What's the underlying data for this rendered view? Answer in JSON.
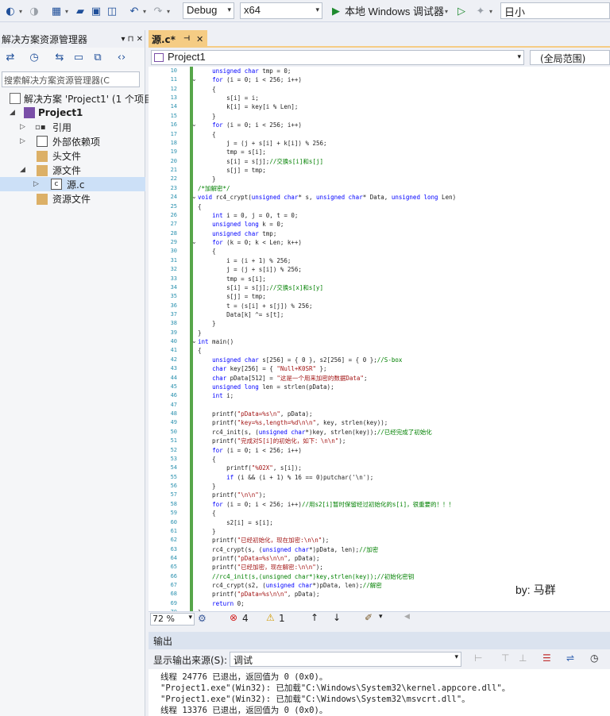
{
  "toolbar": {
    "config": "Debug",
    "platform": "x64",
    "run_label": "本地 Windows 调试器",
    "search": "日小"
  },
  "solution_explorer": {
    "title": "解决方案资源管理器",
    "pin": "▾ ⊓ ✕",
    "search_placeholder": "搜索解决方案资源管理器(C",
    "items": [
      {
        "label": "解决方案 'Project1' (1 个项目"
      },
      {
        "label": "Project1"
      },
      {
        "label": "引用"
      },
      {
        "label": "外部依赖项"
      },
      {
        "label": "头文件"
      },
      {
        "label": "源文件"
      },
      {
        "label": "源.c"
      },
      {
        "label": "资源文件"
      }
    ]
  },
  "editor": {
    "tab": "源.c*",
    "nav_project": "Project1",
    "nav_scope": "(全局范围)",
    "zoom": "72 %",
    "errors": "4",
    "warnings": "1",
    "byline": "by:  马群",
    "lines": [
      {
        "n": "10",
        "t": "    unsigned char tmp = 0;"
      },
      {
        "n": "11",
        "t": "    for (i = 0; i < 256; i++)"
      },
      {
        "n": "12",
        "t": "    {"
      },
      {
        "n": "13",
        "t": "        s[i] = i;"
      },
      {
        "n": "14",
        "t": "        k[i] = key[i % Len];"
      },
      {
        "n": "15",
        "t": "    }"
      },
      {
        "n": "16",
        "t": "    for (i = 0; i < 256; i++)"
      },
      {
        "n": "17",
        "t": "    {"
      },
      {
        "n": "18",
        "t": "        j = (j + s[i] + k[i]) % 256;"
      },
      {
        "n": "19",
        "t": "        tmp = s[i];"
      },
      {
        "n": "20",
        "t": "        s[i] = s[j];//交换s[i]和s[j]"
      },
      {
        "n": "21",
        "t": "        s[j] = tmp;"
      },
      {
        "n": "22",
        "t": "    }"
      },
      {
        "n": "23",
        "t": "/*加解密*/"
      },
      {
        "n": "24",
        "t": "void rc4_crypt(unsigned char* s, unsigned char* Data, unsigned long Len)"
      },
      {
        "n": "25",
        "t": "{"
      },
      {
        "n": "26",
        "t": "    int i = 0, j = 0, t = 0;"
      },
      {
        "n": "27",
        "t": "    unsigned long k = 0;"
      },
      {
        "n": "28",
        "t": "    unsigned char tmp;"
      },
      {
        "n": "29",
        "t": "    for (k = 0; k < Len; k++)"
      },
      {
        "n": "30",
        "t": "    {"
      },
      {
        "n": "31",
        "t": "        i = (i + 1) % 256;"
      },
      {
        "n": "32",
        "t": "        j = (j + s[i]) % 256;"
      },
      {
        "n": "33",
        "t": "        tmp = s[i];"
      },
      {
        "n": "34",
        "t": "        s[i] = s[j];//交换s[x]和s[y]"
      },
      {
        "n": "35",
        "t": "        s[j] = tmp;"
      },
      {
        "n": "36",
        "t": "        t = (s[i] + s[j]) % 256;"
      },
      {
        "n": "37",
        "t": "        Data[k] ^= s[t];"
      },
      {
        "n": "38",
        "t": "    }"
      },
      {
        "n": "39",
        "t": "}"
      },
      {
        "n": "40",
        "t": "int main()"
      },
      {
        "n": "41",
        "t": "{"
      },
      {
        "n": "42",
        "t": "    unsigned char s[256] = { 0 }, s2[256] = { 0 };//S-box"
      },
      {
        "n": "43",
        "t": "    char key[256] = { \"Null+K0SR\" };"
      },
      {
        "n": "44",
        "t": "    char pData[512] = \"这是一个用来加密的数据Data\";"
      },
      {
        "n": "45",
        "t": "    unsigned long len = strlen(pData);"
      },
      {
        "n": "46",
        "t": "    int i;"
      },
      {
        "n": "47",
        "t": ""
      },
      {
        "n": "48",
        "t": "    printf(\"pData=%s\\n\", pData);"
      },
      {
        "n": "49",
        "t": "    printf(\"key=%s,length=%d\\n\\n\", key, strlen(key));"
      },
      {
        "n": "50",
        "t": "    rc4_init(s, (unsigned char*)key, strlen(key));//已经完成了初始化"
      },
      {
        "n": "51",
        "t": "    printf(\"完成对S[i]的初始化，如下：\\n\\n\");"
      },
      {
        "n": "52",
        "t": "    for (i = 0; i < 256; i++)"
      },
      {
        "n": "53",
        "t": "    {"
      },
      {
        "n": "54",
        "t": "        printf(\"%02X\", s[i]);"
      },
      {
        "n": "55",
        "t": "        if (i && (i + 1) % 16 == 0)putchar('\\n');"
      },
      {
        "n": "56",
        "t": "    }"
      },
      {
        "n": "57",
        "t": "    printf(\"\\n\\n\");"
      },
      {
        "n": "58",
        "t": "    for (i = 0; i < 256; i++)//用s2[i]暂时保留经过初始化的s[i]，很重要的！！！"
      },
      {
        "n": "59",
        "t": "    {"
      },
      {
        "n": "60",
        "t": "        s2[i] = s[i];"
      },
      {
        "n": "61",
        "t": "    }"
      },
      {
        "n": "62",
        "t": "    printf(\"已经初始化，现在加密:\\n\\n\");"
      },
      {
        "n": "63",
        "t": "    rc4_crypt(s, (unsigned char*)pData, len);//加密"
      },
      {
        "n": "64",
        "t": "    printf(\"pData=%s\\n\\n\", pData);"
      },
      {
        "n": "65",
        "t": "    printf(\"已经加密，现在解密:\\n\\n\");"
      },
      {
        "n": "66",
        "t": "    //rc4_init(s,(unsigned char*)key,strlen(key));//初始化密钥"
      },
      {
        "n": "67",
        "t": "    rc4_crypt(s2, (unsigned char*)pData, len);//解密"
      },
      {
        "n": "68",
        "t": "    printf(\"pData=%s\\n\\n\", pData);"
      },
      {
        "n": "69",
        "t": "    return 0;"
      },
      {
        "n": "70",
        "t": "}"
      }
    ]
  },
  "output": {
    "title": "输出",
    "source_label": "显示输出来源(S):",
    "source_value": "调试",
    "lines": [
      "线程 24776 已退出，返回值为 0 (0x0)。",
      "\"Project1.exe\"(Win32): 已加载\"C:\\Windows\\System32\\kernel.appcore.dll\"。",
      "\"Project1.exe\"(Win32): 已加载\"C:\\Windows\\System32\\msvcrt.dll\"。",
      "线程 13376 已退出，返回值为 0 (0x0)。"
    ]
  },
  "colors": {
    "accent_tab": "#f5cc84",
    "change_bar": "#57a64a",
    "keyword": "#0000ff",
    "string": "#a31515",
    "comment": "#008000"
  }
}
